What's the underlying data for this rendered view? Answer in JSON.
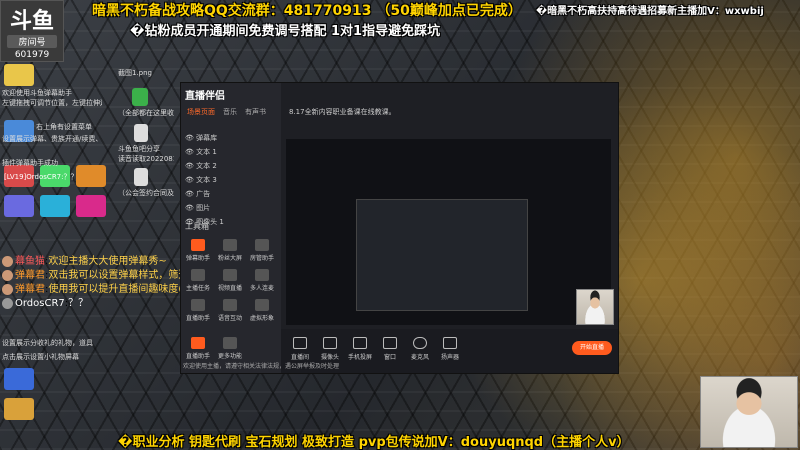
{
  "overlay": {
    "line1": "暗黑不朽备战攻略QQ交流群：481770913 （50巅峰加点已完成）",
    "line2": "�钻粉成员开通期间免费调号搭配 1对1指导避免踩坑",
    "topright": "�暗黑不朽高扶持高待遇招募新主播加V：wxwbij",
    "bottom": "�职业分析 钥匙代刷 宝石规划 极致打造 pvp包传说加V：douyuqnqd（主播个人v）"
  },
  "logo": {
    "brand": "斗鱼",
    "tag": "房间号",
    "room": "601979"
  },
  "desktop": {
    "files": [
      "截图1.png",
      "（全部都在这里收好-无权限请添加）",
      "斗鱼鱼吧分享",
      "读音读取2022081",
      "（公会签约合同及需求）.pdf"
    ],
    "sidebar_text": [
      "欢迎使用斗鱼弹幕助手",
      "左键拖拽可调节位置，左键拉伸边框改变大小",
      "右上角有设置菜单",
      "设置展示弹幕、贵族开通/续费、粉丝牌升级等",
      "插件弹幕助手成功",
      "[LV19]OrdosCR7:？？"
    ],
    "footer_text": [
      "设置展示分收礼的礼物，道具",
      "点击展示设置小礼物屏幕"
    ]
  },
  "chat": [
    {
      "user": "幕鱼猫",
      "text": "欢迎主播大大使用弹幕秀~",
      "user_color": "#ff5a5a",
      "text_color": "#ffd24a"
    },
    {
      "user": "弹幕君",
      "text": "双击我可以设置弹幕样式，筛选展示哦~",
      "user_color": "#ff9a2a",
      "text_color": "#ffd24a"
    },
    {
      "user": "弹幕君",
      "text": "使用我可以提升直播间趣味度(#^0^#)",
      "user_color": "#ff9a2a",
      "text_color": "#ffd24a"
    },
    {
      "user": "OrdosCR7",
      "text": "？？",
      "user_color": "#ffffff",
      "text_color": "#ffffff"
    }
  ],
  "app": {
    "brand": "直播伴侣",
    "tabs": [
      "场景页面",
      "音乐",
      "有声书"
    ],
    "sources": [
      "弹幕库",
      "文本 1",
      "文本 2",
      "文本 3",
      "广告",
      "图片",
      "图像头 1"
    ],
    "tools_title": "工具箱",
    "tools": [
      "弹幕助手",
      "粉丝大屏",
      "房管助手",
      "主播任务",
      "视频直播",
      "多人连麦",
      "直播助手",
      "语音互动",
      "虚拟形象",
      "直播助手",
      "更多功能"
    ],
    "notice": "8.17全新内容职业备课在线教课。",
    "bottom_buttons": [
      "直播间",
      "摄像头",
      "手机投屏",
      "窗口",
      "麦克风",
      "扬声器"
    ],
    "start_live": "开始直播",
    "footer": "欢迎使用主播，请遵守相关法律法规，遇公屏举报及时处理"
  }
}
